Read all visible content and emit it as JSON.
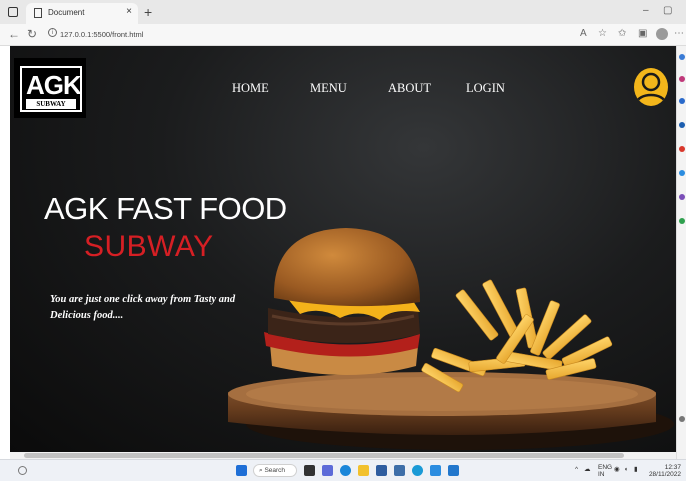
{
  "browser": {
    "tab_title": "Document",
    "tab_close": "×",
    "new_tab": "+",
    "url": "127.0.0.1:5500/front.html",
    "url_info": "i",
    "window_controls": {
      "minimize": "–",
      "maximize": "▢"
    },
    "icons": [
      "back-icon",
      "reload-icon",
      "read-aloud-icon",
      "favorites-icon",
      "collections-icon",
      "profile-icon",
      "more-icon"
    ]
  },
  "site": {
    "logo": {
      "main": "AGK",
      "sub": "SUBWAY"
    },
    "nav": [
      "HOME",
      "MENU",
      "ABOUT",
      "LOGIN"
    ],
    "hero": {
      "title": "AGK FAST FOOD",
      "subtitle": "SUBWAY",
      "tagline": "You are just one click away from Tasty and Delicious food...."
    },
    "colors": {
      "accent_red": "#d61f24",
      "avatar_yellow": "#f3b61b",
      "background": "#151617"
    }
  },
  "taskbar": {
    "search_label": "Search",
    "tray": {
      "lang": "ENG",
      "region": "IN",
      "time": "12:37",
      "date": "28/11/2022"
    }
  }
}
